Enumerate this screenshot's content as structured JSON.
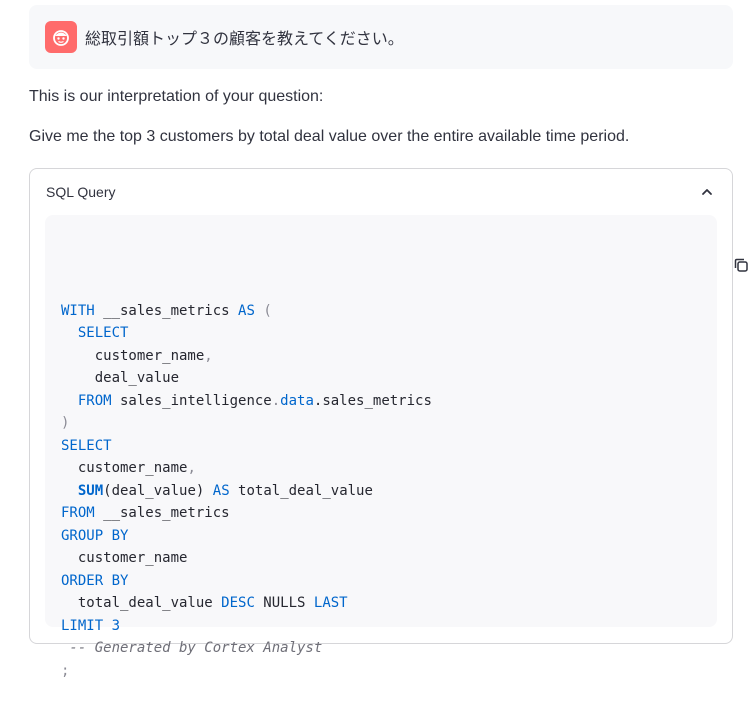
{
  "user_message": {
    "text": "総取引額トップ３の顧客を教えてください。",
    "avatar_icon": "robot-face-icon",
    "avatar_color": "#ff6b6b"
  },
  "assistant": {
    "intro": "This is our interpretation of your question:",
    "interpretation": "Give me the top 3 customers by total deal value over the entire available time period."
  },
  "sql_expander": {
    "title": "SQL Query",
    "toggle_icon": "chevron-up-icon",
    "copy_icon": "copy-icon",
    "lines": [
      [
        {
          "t": "WITH",
          "c": "kw"
        },
        {
          "t": " __sales_metrics "
        },
        {
          "t": "AS",
          "c": "kw"
        },
        {
          "t": " "
        },
        {
          "t": "(",
          "c": "pun"
        }
      ],
      [
        {
          "t": "  "
        },
        {
          "t": "SELECT",
          "c": "kw"
        }
      ],
      [
        {
          "t": "    customer_name"
        },
        {
          "t": ",",
          "c": "pun"
        }
      ],
      [
        {
          "t": "    deal_value"
        }
      ],
      [
        {
          "t": "  "
        },
        {
          "t": "FROM",
          "c": "kw"
        },
        {
          "t": " sales_intelligence"
        },
        {
          "t": ".",
          "c": "pun"
        },
        {
          "t": "data",
          "c": "kw"
        },
        {
          "t": "."
        },
        {
          "t": "sales_metrics"
        }
      ],
      [
        {
          "t": ")",
          "c": "pun"
        }
      ],
      [
        {
          "t": "SELECT",
          "c": "kw"
        }
      ],
      [
        {
          "t": "  customer_name"
        },
        {
          "t": ",",
          "c": "pun"
        }
      ],
      [
        {
          "t": "  "
        },
        {
          "t": "SUM",
          "c": "fn"
        },
        {
          "t": "("
        },
        {
          "t": "deal_value"
        },
        {
          "t": ")"
        },
        {
          "t": " "
        },
        {
          "t": "AS",
          "c": "kw"
        },
        {
          "t": " total_deal_value"
        }
      ],
      [
        {
          "t": "FROM",
          "c": "kw"
        },
        {
          "t": " __sales_metrics"
        }
      ],
      [
        {
          "t": "GROUP BY",
          "c": "kw"
        }
      ],
      [
        {
          "t": "  customer_name"
        }
      ],
      [
        {
          "t": "ORDER BY",
          "c": "kw"
        }
      ],
      [
        {
          "t": "  total_deal_value "
        },
        {
          "t": "DESC",
          "c": "kw"
        },
        {
          "t": " NULLS "
        },
        {
          "t": "LAST",
          "c": "kw"
        }
      ],
      [
        {
          "t": "LIMIT",
          "c": "kw"
        },
        {
          "t": " "
        },
        {
          "t": "3",
          "c": "num"
        }
      ],
      [
        {
          "t": " -- Generated by Cortex Analyst",
          "c": "cm"
        }
      ],
      [
        {
          "t": ";",
          "c": "pun"
        }
      ]
    ]
  }
}
